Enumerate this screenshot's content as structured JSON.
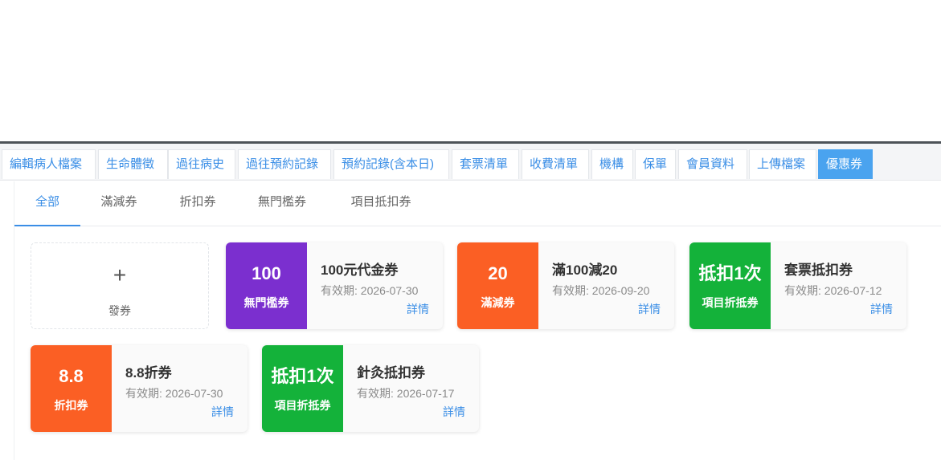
{
  "colors": {
    "accent": "#3a8ee6",
    "active_tab_bg": "#4aa3ef",
    "purple": "#7b2fcf",
    "orange": "#fb5f24",
    "green": "#14b23a"
  },
  "tabs": [
    {
      "label": "編輯病人檔案",
      "active": false
    },
    {
      "label": "生命體徵",
      "active": false
    },
    {
      "label": "過往病史",
      "active": false
    },
    {
      "label": "過往預約記錄",
      "active": false
    },
    {
      "label": "預約記錄(含本日)",
      "active": false
    },
    {
      "label": "套票清單",
      "active": false
    },
    {
      "label": "收費清單",
      "active": false
    },
    {
      "label": "機構",
      "active": false
    },
    {
      "label": "保單",
      "active": false
    },
    {
      "label": "會員資料",
      "active": false
    },
    {
      "label": "上傳檔案",
      "active": false
    },
    {
      "label": "優惠券",
      "active": true
    }
  ],
  "subtabs": [
    {
      "label": "全部",
      "active": true
    },
    {
      "label": "滿減券",
      "active": false
    },
    {
      "label": "折扣券",
      "active": false
    },
    {
      "label": "無門檻券",
      "active": false
    },
    {
      "label": "項目抵扣券",
      "active": false
    }
  ],
  "issue_card": {
    "icon": "plus-icon",
    "plus": "+",
    "label": "發券"
  },
  "coupons": [
    {
      "value": "100",
      "type": "無門檻券",
      "color": "#7b2fcf",
      "name": "100元代金券",
      "valid_label": "有效期:",
      "valid_date": "2026-07-30",
      "detail": "詳情"
    },
    {
      "value": "20",
      "type": "滿減券",
      "color": "#fb5f24",
      "name": "滿100減20",
      "valid_label": "有效期:",
      "valid_date": "2026-09-20",
      "detail": "詳情"
    },
    {
      "value": "抵扣1次",
      "type": "項目折抵券",
      "color": "#14b23a",
      "name": "套票抵扣券",
      "valid_label": "有效期:",
      "valid_date": "2026-07-12",
      "detail": "詳情"
    },
    {
      "value": "8.8",
      "type": "折扣券",
      "color": "#fb5f24",
      "name": "8.8折券",
      "valid_label": "有效期:",
      "valid_date": "2026-07-30",
      "detail": "詳情"
    },
    {
      "value": "抵扣1次",
      "type": "項目折抵券",
      "color": "#14b23a",
      "name": "針灸抵扣券",
      "valid_label": "有效期:",
      "valid_date": "2026-07-17",
      "detail": "詳情"
    }
  ]
}
